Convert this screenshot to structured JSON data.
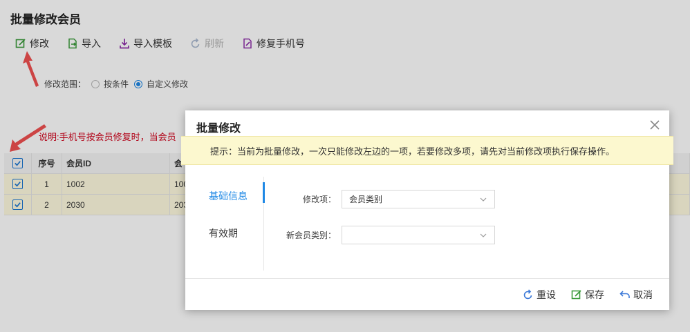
{
  "page": {
    "title": "批量修改会员",
    "toolbar": {
      "edit": "修改",
      "import": "导入",
      "import_template": "导入模板",
      "refresh": "刷新",
      "fix_phone": "修复手机号"
    },
    "range": {
      "label": "修改范围：",
      "by_condition": "按条件",
      "custom": "自定义修改"
    },
    "note": "说明:手机号按会员修复时，当会员",
    "grid": {
      "headers": [
        "序号",
        "会员ID",
        "会"
      ],
      "rows": [
        {
          "no": "1",
          "id": "1002",
          "rest": "100"
        },
        {
          "no": "2",
          "id": "2030",
          "rest": "203"
        }
      ]
    }
  },
  "dialog": {
    "title": "批量修改",
    "hint": "提示：当前为批量修改，一次只能修改左边的一项，若要修改多项，请先对当前修改项执行保存操作。",
    "nav": [
      "基础信息",
      "有效期"
    ],
    "form": {
      "field_label": "修改项：",
      "field_value": "会员类别",
      "new_label": "新会员类别：",
      "new_value": ""
    },
    "footer": {
      "reset": "重设",
      "save": "保存",
      "cancel": "取消"
    }
  },
  "colors": {
    "accent": "#1e88e5",
    "note_red": "#d0021b",
    "hint_bg": "#fcf8cf",
    "row_highlight": "#fffbe0",
    "arrow_red": "#f05050"
  }
}
